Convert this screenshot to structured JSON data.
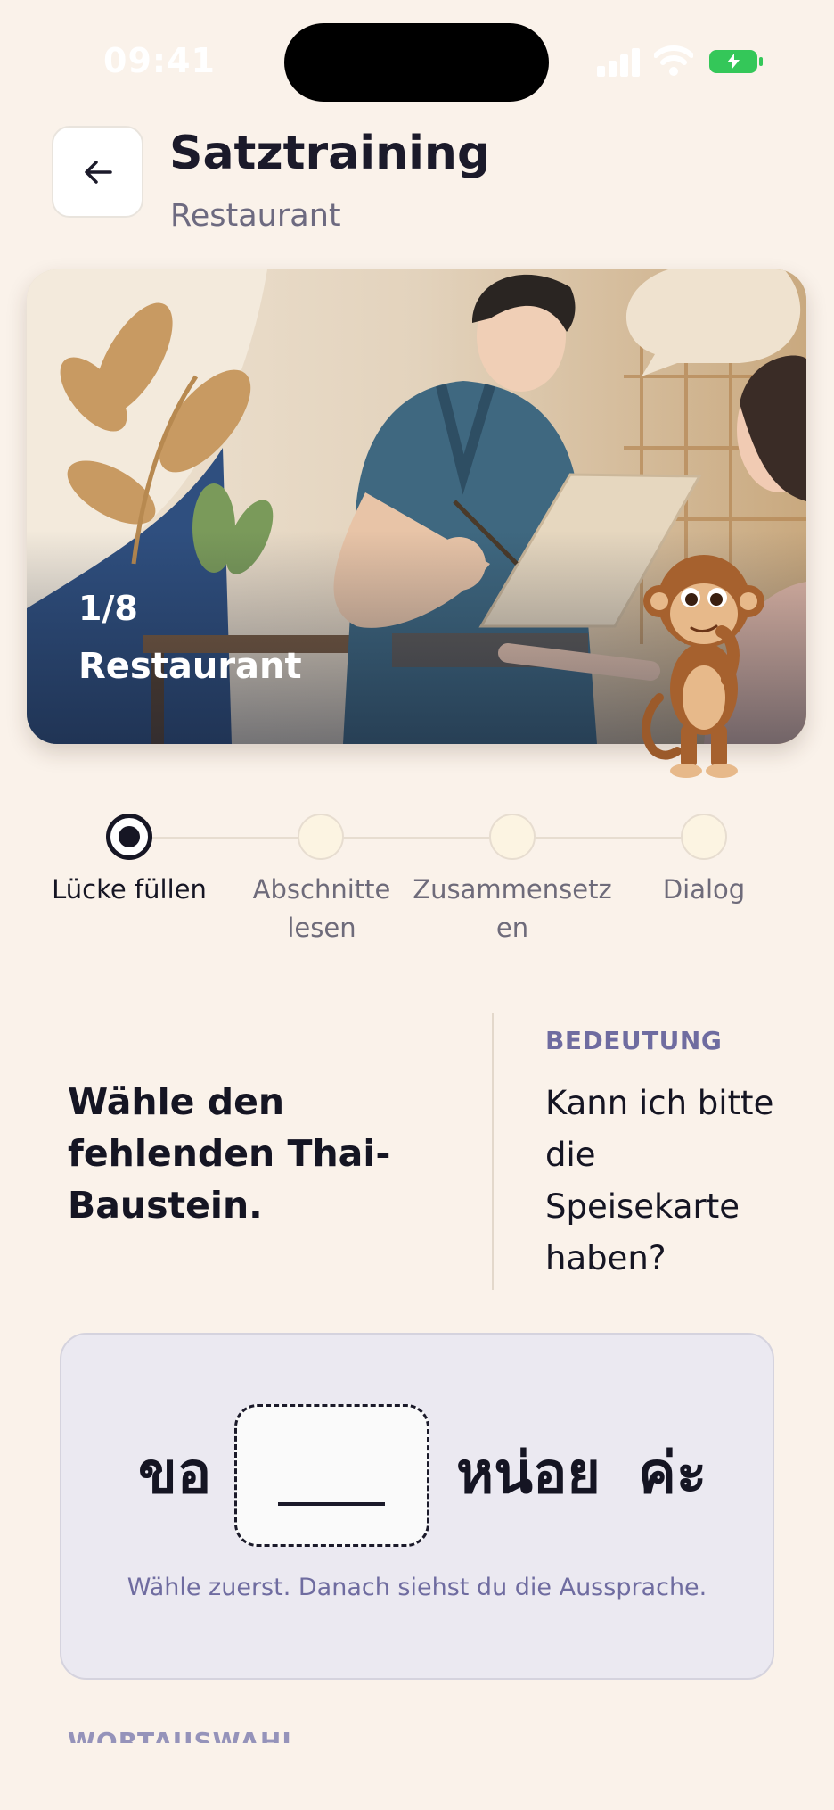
{
  "status": {
    "time": "09:41"
  },
  "header": {
    "title": "Satztraining",
    "subtitle": "Restaurant",
    "back_icon": "arrow-left-icon"
  },
  "hero": {
    "progress": "1/8",
    "caption": "Restaurant"
  },
  "steps": [
    {
      "label": "Lücke füllen",
      "active": true
    },
    {
      "label": "Abschnitte lesen",
      "active": false
    },
    {
      "label": "Zusammensetzen",
      "active": false
    },
    {
      "label": "Dialog",
      "active": false
    }
  ],
  "instruction": "Wähle den fehlenden Thai-Baustein.",
  "meaning": {
    "label": "BEDEUTUNG",
    "text": "Kann ich bitte die Speisekarte haben?"
  },
  "exercise": {
    "word_before": "ขอ",
    "blank": "____",
    "word_after_1": "หน่อย",
    "word_after_2": "ค่ะ",
    "hint": "Wähle zuerst. Danach siehst du die Aussprache."
  },
  "word_choice_label": "WORTAUSWAHL"
}
